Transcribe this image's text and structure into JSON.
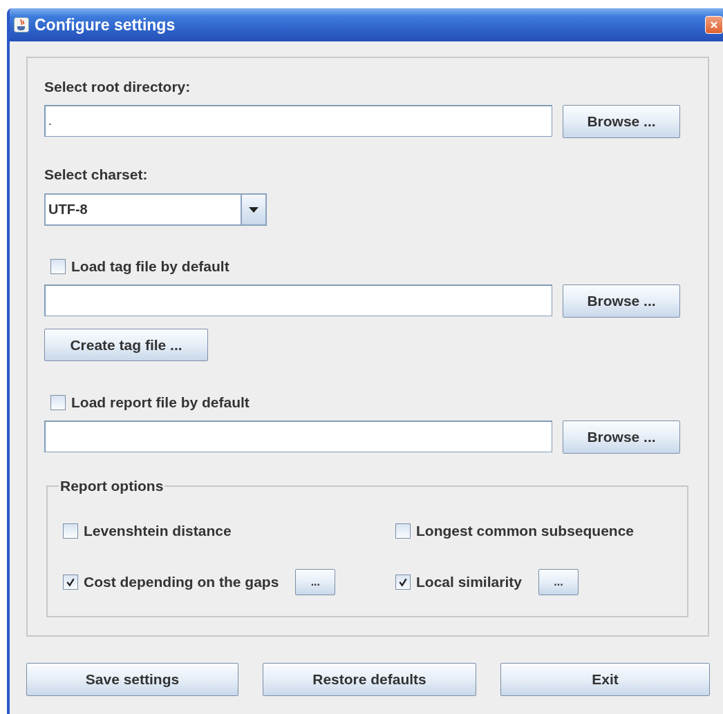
{
  "window": {
    "title": "Configure settings"
  },
  "root": {
    "label": "Select root directory:",
    "value": ".",
    "button": "Browse ..."
  },
  "charset": {
    "label": "Select charset:",
    "value": "UTF-8"
  },
  "tag_file": {
    "label": "Load tag file by default",
    "checked": false,
    "button": "Browse ...",
    "create_button": "Create tag file ..."
  },
  "report_file": {
    "label": "Load report file by default",
    "checked": false,
    "button": "Browse ..."
  },
  "report_options": {
    "title": "Report options",
    "options": [
      {
        "label": "Levenshtein distance",
        "checked": false
      },
      {
        "label": "Longest common subsequence",
        "checked": false
      },
      {
        "label": "Cost depending on the gaps",
        "checked": true,
        "button": "..."
      },
      {
        "label": "Local similarity",
        "checked": true,
        "button": "..."
      }
    ]
  },
  "buttons": [
    "Save settings",
    "Restore defaults",
    "Exit"
  ]
}
